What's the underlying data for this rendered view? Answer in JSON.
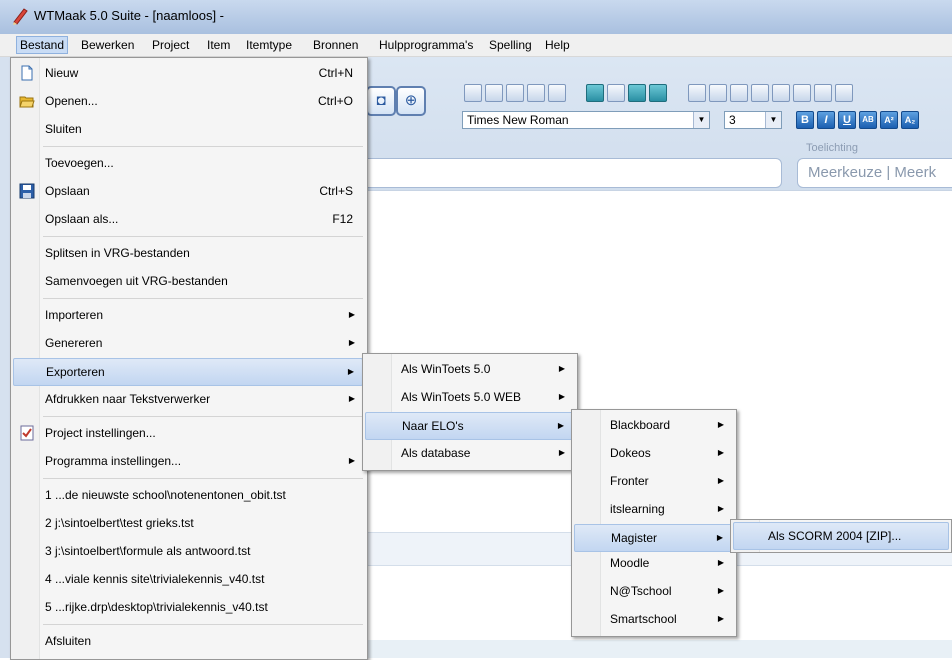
{
  "window": {
    "title": "WTMaak 5.0 Suite - [naamloos] -"
  },
  "menubar": {
    "items": [
      "Bestand",
      "Bewerken",
      "Project",
      "Item",
      "Itemtype",
      "Bronnen",
      "Hulpprogramma's",
      "Spelling",
      "Help"
    ]
  },
  "toolbar": {
    "font_value": "Times New Roman",
    "size_value": "3",
    "format_buttons": [
      "B",
      "I",
      "U",
      "AB",
      "A²",
      "A₂"
    ],
    "toelichting_label": "Toelichting",
    "item_type_value": "Meerkeuze | Meerk"
  },
  "file_menu": {
    "items": [
      {
        "label": "Nieuw",
        "shortcut": "Ctrl+N",
        "icon": "new-document-icon"
      },
      {
        "label": "Openen...",
        "shortcut": "Ctrl+O",
        "icon": "open-folder-icon"
      },
      {
        "label": "Sluiten",
        "shortcut": ""
      },
      {
        "label": "Toevoegen...",
        "shortcut": ""
      },
      {
        "label": "Opslaan",
        "shortcut": "Ctrl+S",
        "icon": "save-disk-icon"
      },
      {
        "label": "Opslaan als...",
        "shortcut": "F12"
      },
      {
        "label": "Splitsen in VRG-bestanden",
        "shortcut": ""
      },
      {
        "label": "Samenvoegen uit VRG-bestanden",
        "shortcut": ""
      },
      {
        "label": "Importeren",
        "shortcut": "",
        "submenu": true
      },
      {
        "label": "Genereren",
        "shortcut": "",
        "submenu": true
      },
      {
        "label": "Exporteren",
        "shortcut": "",
        "submenu": true,
        "highlighted": true
      },
      {
        "label": "Afdrukken naar Tekstverwerker",
        "shortcut": "",
        "submenu": true
      },
      {
        "label": "Project instellingen...",
        "shortcut": "",
        "icon": "checklist-icon"
      },
      {
        "label": "Programma instellingen...",
        "shortcut": "",
        "submenu": true
      },
      {
        "label": "1 ...de nieuwste school\\notenentonen_obit.tst",
        "shortcut": ""
      },
      {
        "label": "2 j:\\sintoelbert\\test grieks.tst",
        "shortcut": ""
      },
      {
        "label": "3 j:\\sintoelbert\\formule als antwoord.tst",
        "shortcut": ""
      },
      {
        "label": "4 ...viale kennis site\\trivialekennis_v40.tst",
        "shortcut": ""
      },
      {
        "label": "5 ...rijke.drp\\desktop\\trivialekennis_v40.tst",
        "shortcut": ""
      },
      {
        "label": "Afsluiten",
        "shortcut": ""
      }
    ]
  },
  "export_menu": {
    "items": [
      {
        "label": "Als WinToets 5.0"
      },
      {
        "label": "Als WinToets 5.0 WEB"
      },
      {
        "label": "Naar ELO's",
        "highlighted": true
      },
      {
        "label": "Als database"
      }
    ]
  },
  "elo_menu": {
    "items": [
      {
        "label": "Blackboard"
      },
      {
        "label": "Dokeos"
      },
      {
        "label": "Fronter"
      },
      {
        "label": "itslearning"
      },
      {
        "label": "Magister",
        "highlighted": true
      },
      {
        "label": "Moodle"
      },
      {
        "label": "N@Tschool"
      },
      {
        "label": "Smartschool"
      }
    ]
  },
  "magister_menu": {
    "items": [
      {
        "label": "Als SCORM 2004 [ZIP]...",
        "highlighted": true
      }
    ]
  },
  "submenu_arrow": "▶"
}
